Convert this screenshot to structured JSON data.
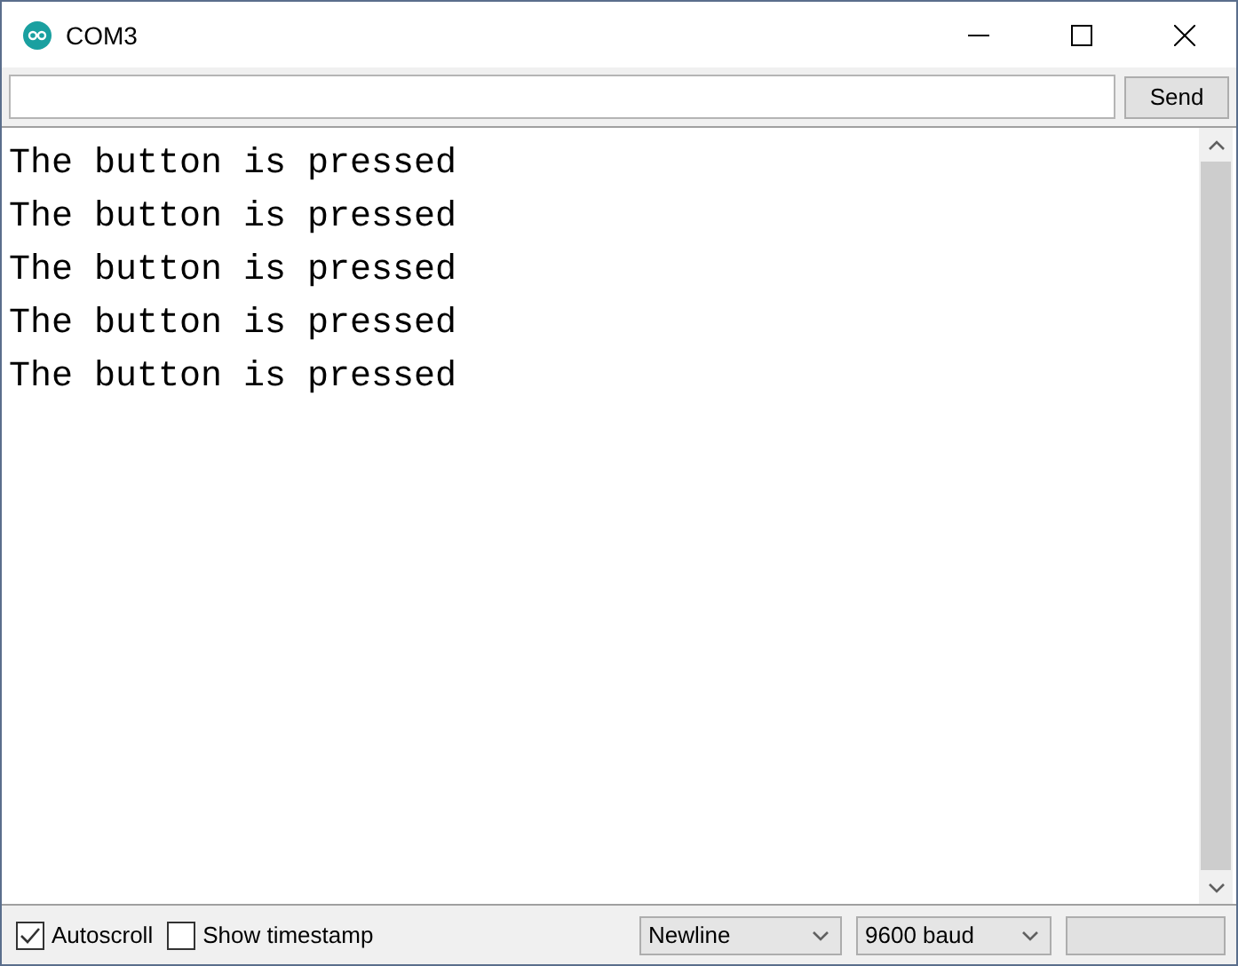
{
  "window": {
    "title": "COM3"
  },
  "input": {
    "send_label": "Send"
  },
  "output_lines": [
    "The button is pressed",
    "The button is pressed",
    "The button is pressed",
    "The button is pressed",
    "The button is pressed"
  ],
  "status_bar": {
    "autoscroll": {
      "label": "Autoscroll",
      "checked": true
    },
    "timestamp": {
      "label": "Show timestamp",
      "checked": false
    },
    "line_ending": "Newline",
    "baud": "9600 baud"
  }
}
